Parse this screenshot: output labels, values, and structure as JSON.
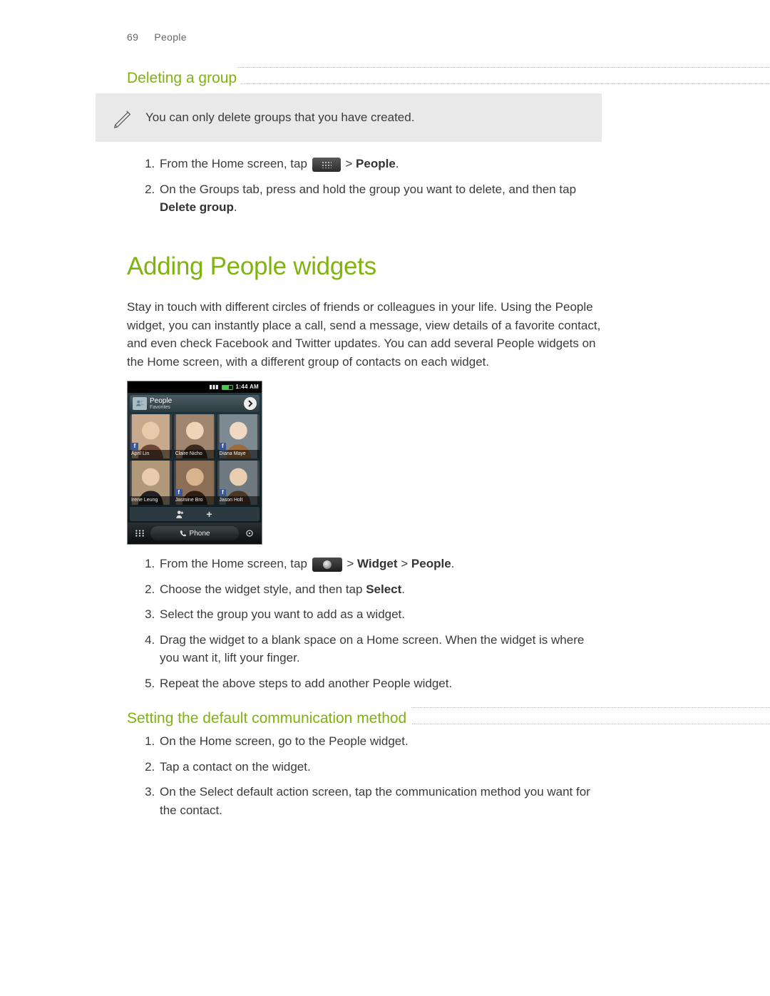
{
  "header": {
    "page_number": "69",
    "section": "People"
  },
  "section_deleting": {
    "title": "Deleting a group",
    "note": "You can only delete groups that you have created.",
    "steps": [
      {
        "prefix": "From the Home screen, tap ",
        "suffix1": " > ",
        "bold1": "People",
        "suffix2": "."
      },
      {
        "prefix": "On the Groups tab, press and hold the group you want to delete, and then tap ",
        "bold1": "Delete group",
        "suffix2": "."
      }
    ]
  },
  "section_widgets": {
    "title": "Adding People widgets",
    "intro": "Stay in touch with different circles of friends or colleagues in your life. Using the People widget, you can instantly place a call, send a message, view details of a favorite contact, and even check Facebook and Twitter updates. You can add several People widgets on the Home screen, with a different group of contacts on each widget.",
    "phone": {
      "time": "1:44 AM",
      "widget_title": "People",
      "widget_subtitle": "Favorites",
      "contacts": [
        "April Lin",
        "Claire Nicho",
        "Diana Maye",
        "Irene Leung",
        "Jasmine Bro",
        "Jason Holt"
      ],
      "dock_label": "Phone"
    },
    "steps": [
      {
        "prefix": "From the Home screen, tap ",
        "suffix1": " > ",
        "bold1": "Widget",
        "mid": " > ",
        "bold2": "People",
        "suffix2": "."
      },
      {
        "prefix": "Choose the widget style, and then tap ",
        "bold1": "Select",
        "suffix2": "."
      },
      {
        "plain": "Select the group you want to add as a widget."
      },
      {
        "plain": "Drag the widget to a blank space on a Home screen. When the widget is where you want it, lift your finger."
      },
      {
        "plain": "Repeat the above steps to add another People widget."
      }
    ]
  },
  "section_default_method": {
    "title": "Setting the default communication method",
    "steps": [
      {
        "plain": "On the Home screen, go to the People widget."
      },
      {
        "plain": "Tap a contact on the widget."
      },
      {
        "plain": "On the Select default action screen, tap the communication method you want for the contact."
      }
    ]
  }
}
